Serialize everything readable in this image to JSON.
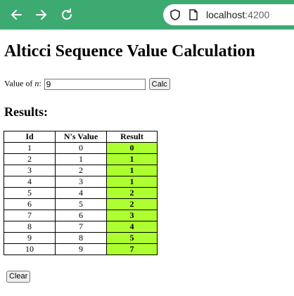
{
  "browser": {
    "url_host": "localhost",
    "url_port": ":4200",
    "nav_icons": [
      "back-arrow-icon",
      "forward-arrow-icon",
      "reload-icon",
      "shield-icon",
      "page-icon"
    ]
  },
  "page": {
    "title": "Alticci Sequence Value Calculation",
    "input_label_prefix": "Value of ",
    "input_label_var": "n",
    "input_label_suffix": ":",
    "input_value": "9",
    "calc_label": "Calc",
    "results_heading": "Results:",
    "clear_label": "Clear"
  },
  "table": {
    "headers": [
      "Id",
      "N's Value",
      "Result"
    ],
    "rows": [
      [
        "1",
        "0",
        "0"
      ],
      [
        "2",
        "1",
        "1"
      ],
      [
        "3",
        "2",
        "1"
      ],
      [
        "4",
        "3",
        "1"
      ],
      [
        "5",
        "4",
        "2"
      ],
      [
        "6",
        "5",
        "2"
      ],
      [
        "7",
        "6",
        "3"
      ],
      [
        "8",
        "7",
        "4"
      ],
      [
        "9",
        "8",
        "5"
      ],
      [
        "10",
        "9",
        "7"
      ]
    ],
    "result_highlight_color": "#adff2f"
  }
}
